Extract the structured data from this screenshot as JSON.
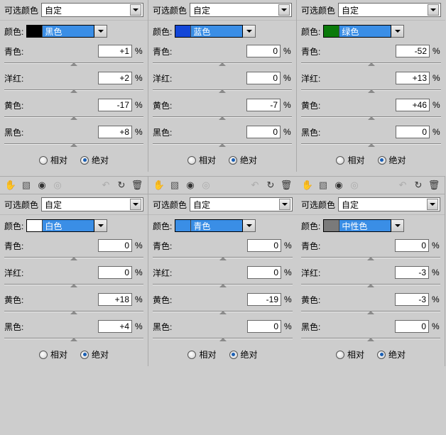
{
  "labels": {
    "selective": "可选颜色",
    "preset": "自定",
    "color": "颜色:",
    "cyan": "青色:",
    "magenta": "洋红:",
    "yellow": "黄色:",
    "black": "黑色:",
    "relative": "相对",
    "absolute": "绝对",
    "percent": "%"
  },
  "panels": [
    {
      "swatch_name": "黑色",
      "swatch_color": "#000000",
      "cyan": "+1",
      "magenta": "+2",
      "yellow": "-17",
      "black": "+8",
      "radio": "absolute"
    },
    {
      "swatch_name": "蓝色",
      "swatch_color": "#1246d8",
      "cyan": "0",
      "magenta": "0",
      "yellow": "-7",
      "black": "0",
      "radio": "absolute"
    },
    {
      "swatch_name": "绿色",
      "swatch_color": "#0a7a0a",
      "cyan": "-52",
      "magenta": "+13",
      "yellow": "+46",
      "black": "0",
      "radio": "absolute"
    },
    {
      "swatch_name": "白色",
      "swatch_color": "#ffffff",
      "cyan": "0",
      "magenta": "0",
      "yellow": "+18",
      "black": "+4",
      "radio": "absolute"
    },
    {
      "swatch_name": "青色",
      "swatch_color": "#3a8ee6",
      "cyan": "0",
      "magenta": "0",
      "yellow": "-19",
      "black": "0",
      "radio": "absolute"
    },
    {
      "swatch_name": "中性色",
      "swatch_color": "#7a7a7a",
      "cyan": "0",
      "magenta": "-3",
      "yellow": "-3",
      "black": "0",
      "radio": "absolute"
    }
  ]
}
